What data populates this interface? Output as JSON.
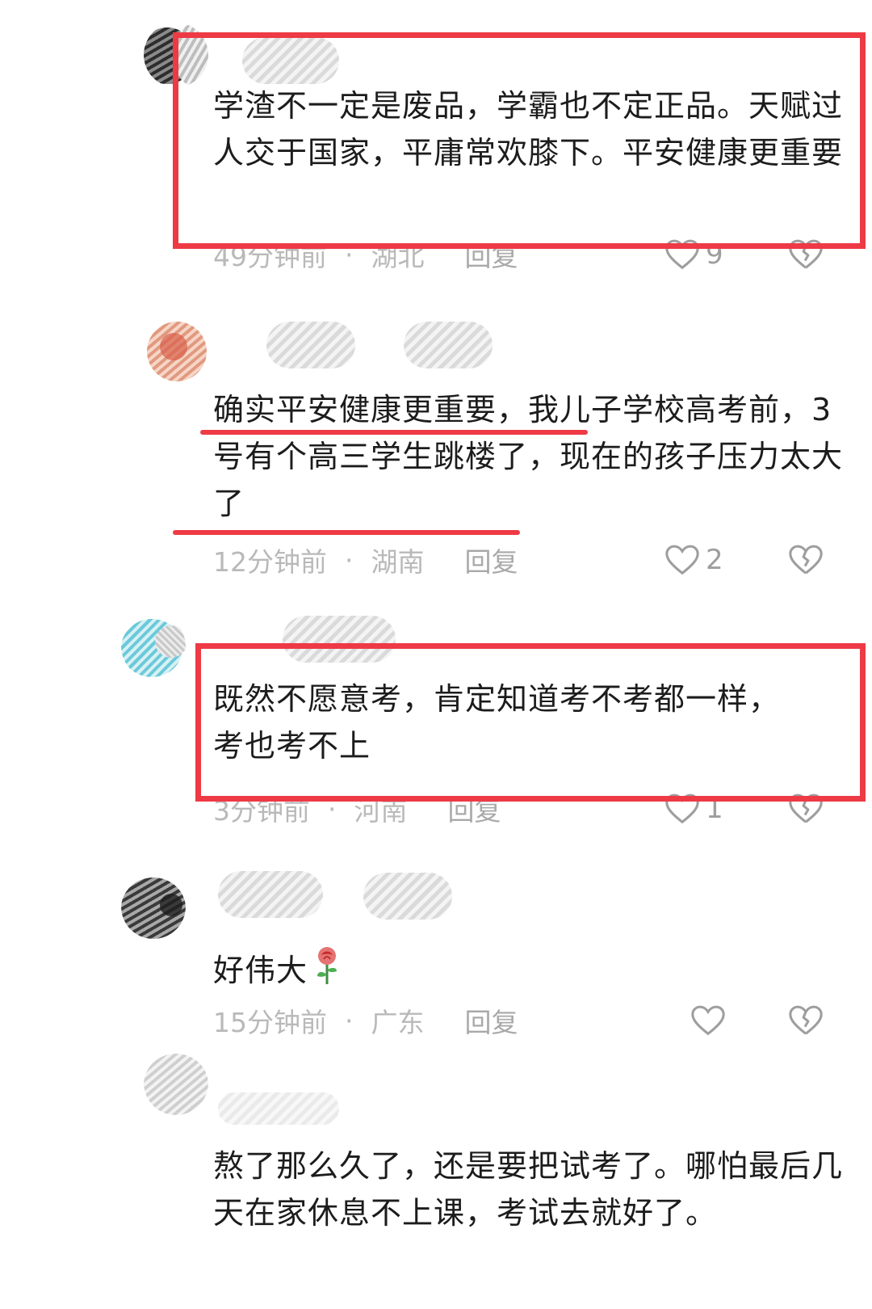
{
  "comments": [
    {
      "text": "学渣不一定是废品，学霸也不定正品。天赋过人交于国家，平庸常欢膝下。平安健康更重要",
      "time": "49分钟前",
      "dot": "·",
      "region": "湖北",
      "reply": "回复",
      "likes": "9"
    },
    {
      "text": "确实平安健康更重要，我儿子学校高考前，3号有个高三学生跳楼了，现在的孩子压力太大了",
      "time": "12分钟前",
      "dot": "·",
      "region": "湖南",
      "reply": "回复",
      "likes": "2"
    },
    {
      "text": "既然不愿意考，肯定知道考不考都一样，考也考不上",
      "time": "3分钟前",
      "dot": "·",
      "region": "河南",
      "reply": "回复",
      "likes": "1"
    },
    {
      "text": "好伟大",
      "time": "15分钟前",
      "dot": "·",
      "region": "广东",
      "reply": "回复",
      "likes": ""
    },
    {
      "text": "熬了那么久了，还是要把试考了。哪怕最后几天在家休息不上课，考试去就好了。"
    }
  ],
  "colors": {
    "highlight": "#ee3a45",
    "text": "#1c1c1c",
    "meta": "#b9b9b9"
  },
  "icons": {
    "like": "heart-outline-icon",
    "dislike": "broken-heart-icon",
    "emoji": "rose-emoji"
  }
}
